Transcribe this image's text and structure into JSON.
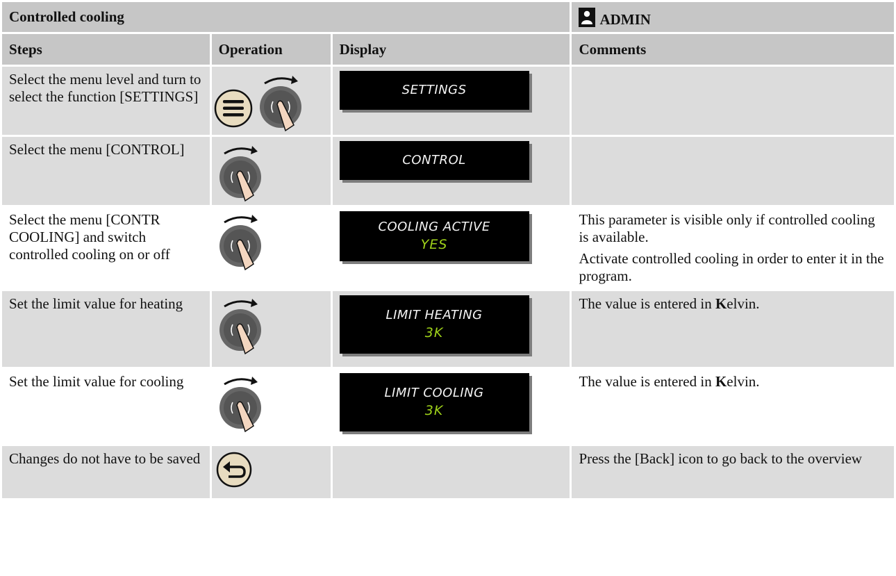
{
  "header": {
    "title": "Controlled cooling",
    "role": "ADMIN"
  },
  "columns": {
    "steps": "Steps",
    "operation": "Operation",
    "display": "Display",
    "comments": "Comments"
  },
  "rows": [
    {
      "step": "Select the menu level and turn to select the function [SETTINGS]",
      "icons": [
        "menu-button-icon",
        "rotary-knob-icon"
      ],
      "display_line1": "SETTINGS",
      "display_line2": "",
      "comments": []
    },
    {
      "step": "Select the menu [CONTROL]",
      "icons": [
        "rotary-knob-icon"
      ],
      "display_line1": "CONTROL",
      "display_line2": "",
      "comments": []
    },
    {
      "step": "Select the menu [CONTR COOLING] and switch controlled cooling on or off",
      "icons": [
        "rotary-knob-icon"
      ],
      "display_line1": "COOLING ACTIVE",
      "display_line2": "YES",
      "comments": [
        "This parameter is visible only if controlled cooling is available.",
        "Activate controlled cooling in order to enter it in the program."
      ]
    },
    {
      "step": "Set the limit value for heating",
      "icons": [
        "rotary-knob-icon"
      ],
      "display_line1": "LIMIT HEATING",
      "display_line2": "3K",
      "comments": [
        "The value is entered in Kelvin."
      ]
    },
    {
      "step": "Set the limit value for cooling",
      "icons": [
        "rotary-knob-icon"
      ],
      "display_line1": "LIMIT COOLING",
      "display_line2": "3K",
      "comments": [
        "The value is entered in Kelvin."
      ]
    },
    {
      "step": "Changes do not have to be saved",
      "icons": [
        "back-button-icon"
      ],
      "display_line1": "",
      "display_line2": "",
      "comments": [
        "Press the [Back] icon to go back to the overview"
      ]
    }
  ],
  "colors": {
    "header_bg": "#c6c6c6",
    "row_grey": "#dcdcdc",
    "lcd_text": "#f4f4f4",
    "lcd_value": "#9fd21a",
    "button_face": "#e8dcc0"
  }
}
